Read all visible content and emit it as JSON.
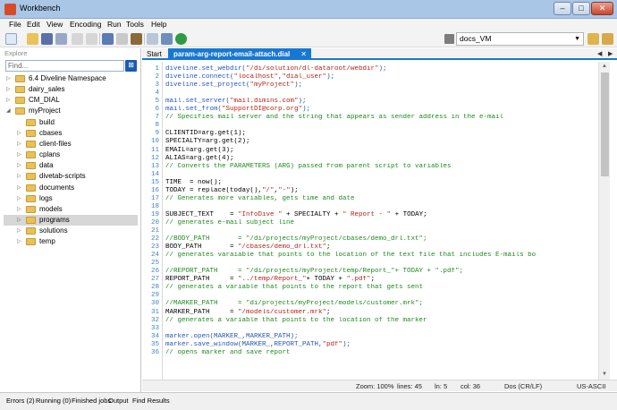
{
  "window": {
    "title": "Workbench",
    "min_glyph": "–",
    "max_glyph": "□",
    "close_glyph": "✕"
  },
  "menu": [
    "File",
    "Edit",
    "View",
    "Encoding",
    "Run",
    "Tools",
    "Help"
  ],
  "toolbar": {
    "project": "docs_VM"
  },
  "explorer": {
    "title": "Explore",
    "find_placeholder": "Find...",
    "tree": [
      {
        "label": "6.4 Diveline Namespace",
        "expanded": false,
        "level": 0
      },
      {
        "label": "dairy_sales",
        "expanded": false,
        "level": 0
      },
      {
        "label": "CM_DIAL",
        "expanded": false,
        "level": 0
      },
      {
        "label": "myProject",
        "expanded": true,
        "level": 0
      },
      {
        "label": "build",
        "expanded": false,
        "level": 1,
        "leaf": true
      },
      {
        "label": "cbases",
        "expanded": false,
        "level": 1
      },
      {
        "label": "client-files",
        "expanded": false,
        "level": 1
      },
      {
        "label": "cplans",
        "expanded": false,
        "level": 1
      },
      {
        "label": "data",
        "expanded": false,
        "level": 1
      },
      {
        "label": "divetab-scripts",
        "expanded": false,
        "level": 1
      },
      {
        "label": "documents",
        "expanded": false,
        "level": 1
      },
      {
        "label": "logs",
        "expanded": false,
        "level": 1
      },
      {
        "label": "models",
        "expanded": false,
        "level": 1
      },
      {
        "label": "programs",
        "expanded": false,
        "level": 1,
        "selected": true
      },
      {
        "label": "solutions",
        "expanded": false,
        "level": 1
      },
      {
        "label": "temp",
        "expanded": false,
        "level": 1
      }
    ]
  },
  "tabs": {
    "start": "Start",
    "active": "param-arg-report-email-attach.dial",
    "close_glyph": "✕"
  },
  "editor": {
    "lines": [
      "diveline.set_webdir(\"/di/solution/dl-dataroot/webdir\");",
      "diveline.connect(\"localhost\",\"dial_user\");",
      "diveline.set_project(\"myProject\");",
      "",
      "mail.set_server(\"mail.dimins.com\");",
      "mail.set_from(\"SupportDI@corp.org\");",
      "// Specifies mail server and the string that appears as sender address in the e-mail",
      "",
      "CLIENTID=arg.get(1);",
      "SPECIALTY=arg.get(2);",
      "EMAIL=arg.get(3);",
      "ALIAS=arg.get(4);",
      "// Converts the PARAMETERS (ARG) passed from parent script to variables",
      "",
      "TIME  = now();",
      "TODAY = replace(today(),\"/\",\"-\");",
      "// Generates more variables, gets time and date",
      "",
      "SUBJECT_TEXT    = \"InfoDive \" + SPECIALTY + \" Report - \" + TODAY;",
      "// generates e-mail subject line",
      "",
      "//BODY_PATH       = \"/di/projects/myProject/cbases/demo_drl.txt\";",
      "BODY_PATH       = \"/cbases/demo_drl.txt\";",
      "// generates varaiable that points to the location of the text file that includes E-mails bo",
      "",
      "//REPORT_PATH     = \"/di/projects/myProject/temp/Report_\"+ TODAY + \".pdf\";",
      "REPORT_PATH     = \"../temp/Report_\"+ TODAY + \".pdf\";",
      "// generates a variable that points to the report that gets sent",
      "",
      "//MARKER_PATH     = \"di/projects/myProject/models/customer.mrk\";",
      "MARKER_PATH     = \"/models/customer.mrk\";",
      "// generates a variable that points to the location of the marker",
      "",
      "marker.open(MARKER_,MARKER_PATH);",
      "marker.save_window(MARKER_,REPORT_PATH,\"pdf\");",
      "// opens marker and save report"
    ]
  },
  "status": {
    "zoom": "Zoom: 100%",
    "lines": "lines: 45",
    "ln": "ln: 5",
    "col": "col: 36",
    "eol": "Dos (CR/LF)",
    "encoding": "US-ASCII"
  },
  "bottom_tabs": [
    "Errors (2)",
    "Running (0)",
    "Finished jobs",
    "Output",
    "Find Results"
  ],
  "colors": {
    "accent": "#1778d2",
    "function": "#2556b7",
    "string": "#b42319",
    "comment": "#1e8a1e",
    "linenum": "#3f83c4"
  },
  "icons": [
    "workbench-icon",
    "new-file-icon",
    "open-folder-icon",
    "save-icon",
    "save-all-icon",
    "undo-icon",
    "redo-icon",
    "cut-icon",
    "copy-icon",
    "paste-icon",
    "find-icon",
    "replace-icon",
    "run-icon",
    "project-icon",
    "settings-icon",
    "tools-icon"
  ]
}
